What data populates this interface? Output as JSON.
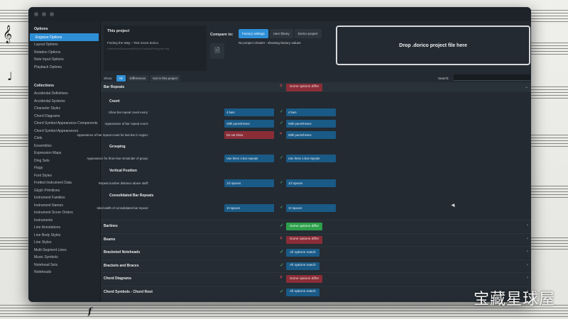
{
  "sidebar": {
    "options_heading": "Options",
    "options": [
      {
        "label": "Engrave Options",
        "active": true
      },
      {
        "label": "Layout Options"
      },
      {
        "label": "Notation Options"
      },
      {
        "label": "Note Input Options"
      },
      {
        "label": "Playback Options"
      }
    ],
    "collections_heading": "Collections",
    "collections": [
      "Accidental Definitions",
      "Accidental Systems",
      "Character Styles",
      "Chord Diagrams",
      "Chord Symbol Appearance Components",
      "Chord Symbol Appearances",
      "Clefs",
      "Ensembles",
      "Expression Maps",
      "Ding Sets",
      "Flags",
      "Font Styles",
      "Fretted Instrument Data",
      "Glyph Primitives",
      "Instrument Families",
      "Instrument Names",
      "Instrument Score Orders",
      "Instruments",
      "Line Annotations",
      "Line Body Styles",
      "Line Styles",
      "Multi-Segment Lines",
      "Music Symbols",
      "Notehead Sets",
      "Noteheads"
    ]
  },
  "project": {
    "heading": "This project",
    "name": "Finding the Way – Test Score.dorico",
    "subtitle": "/Users/user/Documents/Dorico Projects/Finding the Way"
  },
  "compare": {
    "label": "Compare to:",
    "buttons": [
      {
        "label": "Factory settings",
        "active": true
      },
      {
        "label": "User library"
      },
      {
        "label": "Dorico project"
      }
    ],
    "note": "No project chosen - showing factory values"
  },
  "dropzone": {
    "label": "Drop .dorico project file here"
  },
  "filters": {
    "show_label": "Show:",
    "items": [
      {
        "label": "All",
        "active": true
      },
      {
        "label": "Differences"
      },
      {
        "label": "Not in this project"
      }
    ]
  },
  "search": {
    "label": "Search:",
    "placeholder": ""
  },
  "bar_repeats": {
    "title": "Bar Repeats",
    "status": "Some options differ",
    "count_heading": "Count",
    "count_rows": [
      {
        "label": "Show bar repeat count every:",
        "project": "4 bars",
        "mark": "✓",
        "compare": "4 bars",
        "project_bad": false
      },
      {
        "label": "Appearance of bar repeat count:",
        "project": "With parentheses",
        "mark": "✓",
        "compare": "With parentheses",
        "project_bad": false
      },
      {
        "label": "Appearance of bar repeat count for last bar in region:",
        "project": "Do not show",
        "mark": "≠",
        "compare": "With parentheses",
        "project_bad": true
      }
    ],
    "grouping_heading": "Grouping",
    "grouping_rows": [
      {
        "label": "Appearance for three-bar remainder of group:",
        "project": "Use three 1-bar repeats",
        "mark": "✓",
        "compare": "Use three 1-bar repeats",
        "project_bad": false
      }
    ],
    "vertical_heading": "Vertical Position",
    "vertical_rows": [
      {
        "label": "Repeat number distance above staff:",
        "project": "1/2 spaces",
        "mark": "✓",
        "compare": "1/2 spaces",
        "project_bad": false
      }
    ],
    "consolidated_heading": "Consolidated Bar Repeats",
    "consolidated_rows": [
      {
        "label": "Ideal width of consolidated bar repeat:",
        "project": "10 spaces",
        "mark": "✓",
        "compare": "10 spaces",
        "project_bad": false
      }
    ]
  },
  "categories": [
    {
      "title": "Barlines",
      "mark": "✓",
      "status": "Some options differ",
      "kind": "differ-green"
    },
    {
      "title": "Beams",
      "mark": "≠",
      "status": "Some options differ",
      "kind": "differ-red"
    },
    {
      "title": "Bracketed Noteheads",
      "mark": "✓",
      "status": "All options match",
      "kind": "match"
    },
    {
      "title": "Brackets and Braces",
      "mark": "✓",
      "status": "All options match",
      "kind": "match"
    },
    {
      "title": "Chord Diagrams",
      "mark": "≠",
      "status": "Some options differ",
      "kind": "differ-red"
    },
    {
      "title": "Chord Symbols - Chord Root",
      "mark": "✓",
      "status": "All options match",
      "kind": "match"
    }
  ],
  "watermark": "宝藏星球屋",
  "colors": {
    "accent": "#2f8fd6",
    "match": "#1a5a86",
    "differ": "#8b2d37",
    "ok": "#58c07a"
  }
}
